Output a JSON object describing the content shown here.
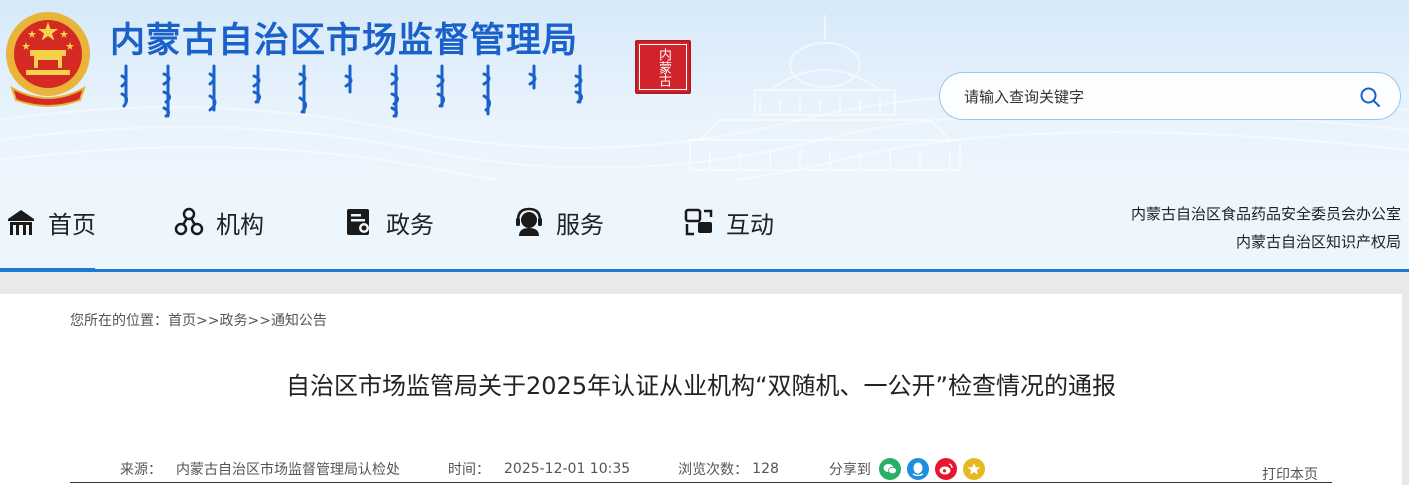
{
  "header": {
    "site_title": "内蒙古自治区市场监督管理局",
    "seal_text": "内蒙古",
    "search": {
      "placeholder": "请输入查询关键字",
      "value": ""
    }
  },
  "nav": {
    "items": [
      {
        "label": "首页",
        "icon": "home-icon",
        "active": true
      },
      {
        "label": "机构",
        "icon": "org-icon",
        "active": false
      },
      {
        "label": "政务",
        "icon": "document-icon",
        "active": false
      },
      {
        "label": "服务",
        "icon": "headset-icon",
        "active": false
      },
      {
        "label": "互动",
        "icon": "interaction-icon",
        "active": false
      }
    ],
    "links": [
      "内蒙古自治区食品药品安全委员会办公室",
      "内蒙古自治区知识产权局"
    ]
  },
  "breadcrumb": {
    "prefix": "您所在的位置：",
    "items": [
      "首页",
      "政务",
      "通知公告"
    ],
    "separator": ">>"
  },
  "article": {
    "title": "自治区市场监管局关于2025年认证从业机构“双随机、一公开”检查情况的通报",
    "source_label": "来源：",
    "source": "内蒙古自治区市场监督管理局认检处",
    "time_label": "时间：",
    "time": "2025-12-01 10:35",
    "views_label": "浏览次数：",
    "views": "128",
    "share_label": "分享到",
    "share_targets": [
      "wechat-icon",
      "qq-icon",
      "weibo-icon",
      "qzone-icon"
    ],
    "print_label": "打印本页"
  },
  "colors": {
    "brand_blue": "#1a61c9",
    "nav_accent": "#1a7ad6",
    "seal_red": "#d2232a"
  }
}
